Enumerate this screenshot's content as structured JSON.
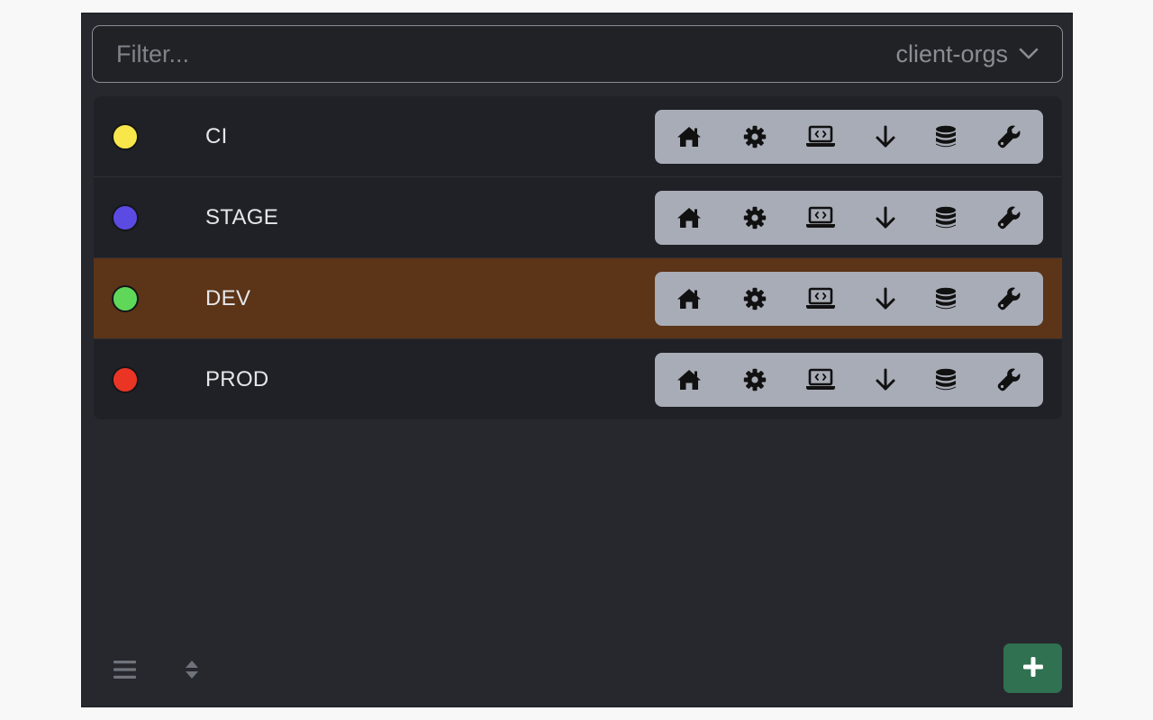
{
  "filter": {
    "placeholder": "Filter...",
    "value": ""
  },
  "org_selector": {
    "selected": "client-orgs",
    "icon": "chevron-down-icon"
  },
  "environments": [
    {
      "name": "CI",
      "color": "#f8e64b",
      "selected": false
    },
    {
      "name": "STAGE",
      "color": "#5b4be3",
      "selected": false
    },
    {
      "name": "DEV",
      "color": "#5fd85a",
      "selected": true
    },
    {
      "name": "PROD",
      "color": "#ea3524",
      "selected": false
    }
  ],
  "row_actions": [
    {
      "icon": "home-icon"
    },
    {
      "icon": "gear-icon"
    },
    {
      "icon": "laptop-code-icon"
    },
    {
      "icon": "arrow-down-icon"
    },
    {
      "icon": "database-icon"
    },
    {
      "icon": "wrench-icon"
    }
  ],
  "footer": {
    "list_icon": "list-icon",
    "sort_icon": "sort-icon",
    "add_icon": "plus-icon"
  },
  "colors": {
    "background": "#27282d",
    "selected_row": "#5c3418",
    "actions_bg": "#a8acb6",
    "add_button": "#2f7150"
  }
}
